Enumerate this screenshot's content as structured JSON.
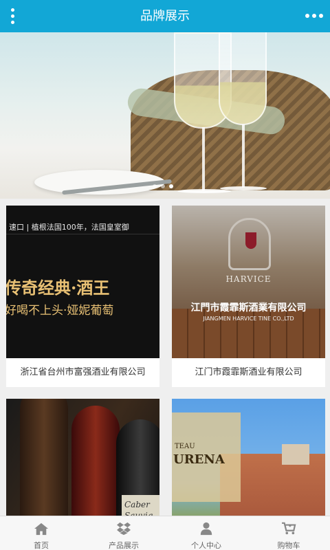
{
  "header": {
    "title": "品牌展示"
  },
  "banner": {
    "slide_count": 3,
    "active_slide": 3
  },
  "brands": [
    {
      "name": "浙江省台州市富强酒业有限公司",
      "image_text": {
        "tagline": "速口 | 植根法国100年，法国皇室御",
        "headline": "传奇经典·酒王",
        "subline": "好喝不上头·娅妮葡萄"
      }
    },
    {
      "name": "江门市霞霏斯酒业有限公司",
      "image_text": {
        "brand": "HARVICE",
        "company_cn": "江門市霞霏斯酒業有限公司",
        "company_en": "JIANGMEN HARVICE TINE CO.,LTD"
      }
    },
    {
      "name": "",
      "image_text": {
        "label": "Caber Sauvig"
      }
    },
    {
      "name": "",
      "image_text": {
        "sign_line1": "TEAU",
        "sign_line2": "URENA"
      }
    }
  ],
  "bottom_nav": {
    "items": [
      {
        "label": "首页",
        "icon": "home-icon"
      },
      {
        "label": "产品展示",
        "icon": "dropbox-icon"
      },
      {
        "label": "个人中心",
        "icon": "user-icon"
      },
      {
        "label": "购物车",
        "icon": "cart-icon"
      }
    ]
  },
  "colors": {
    "accent": "#12a7d6",
    "nav_icon": "#888888"
  }
}
